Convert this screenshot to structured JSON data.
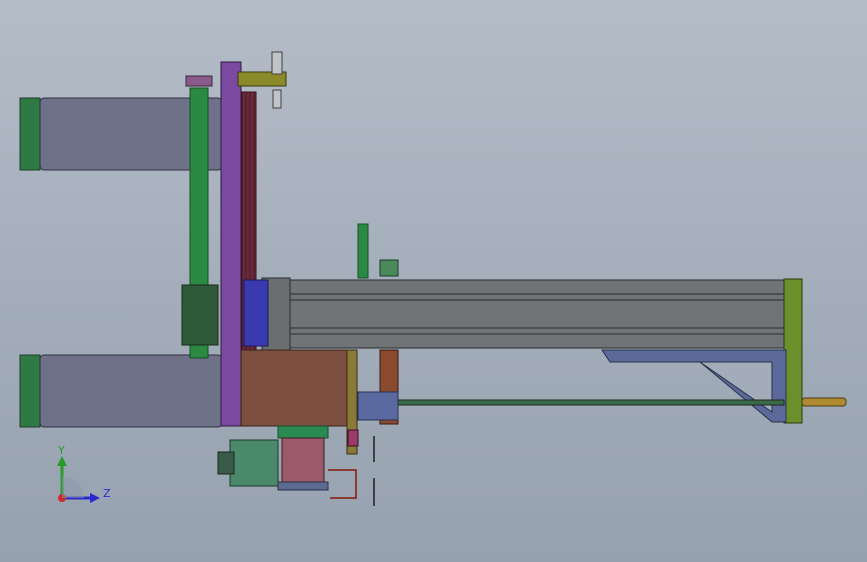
{
  "viewport": {
    "background_top": "#b4bcc7",
    "background_bottom": "#96a1af"
  },
  "colors": {
    "cylinder_body": "#6f7189",
    "cylinder_cap": "#2f7a44",
    "purple_plate": "#7a4aa0",
    "green_rod": "#2a8a42",
    "brown_block": "#7c4e40",
    "rail_body": "#707476",
    "rail_end_cap": "#6b8f2a",
    "blue_bracket": "#5b6a9a",
    "olive_bracket": "#8a8a2a",
    "teal_base": "#4a8a6a",
    "pink_block": "#9a5a6a"
  },
  "triad": {
    "y_label": "Y",
    "z_label": "Z",
    "icon": "coordinate-triad-icon"
  }
}
